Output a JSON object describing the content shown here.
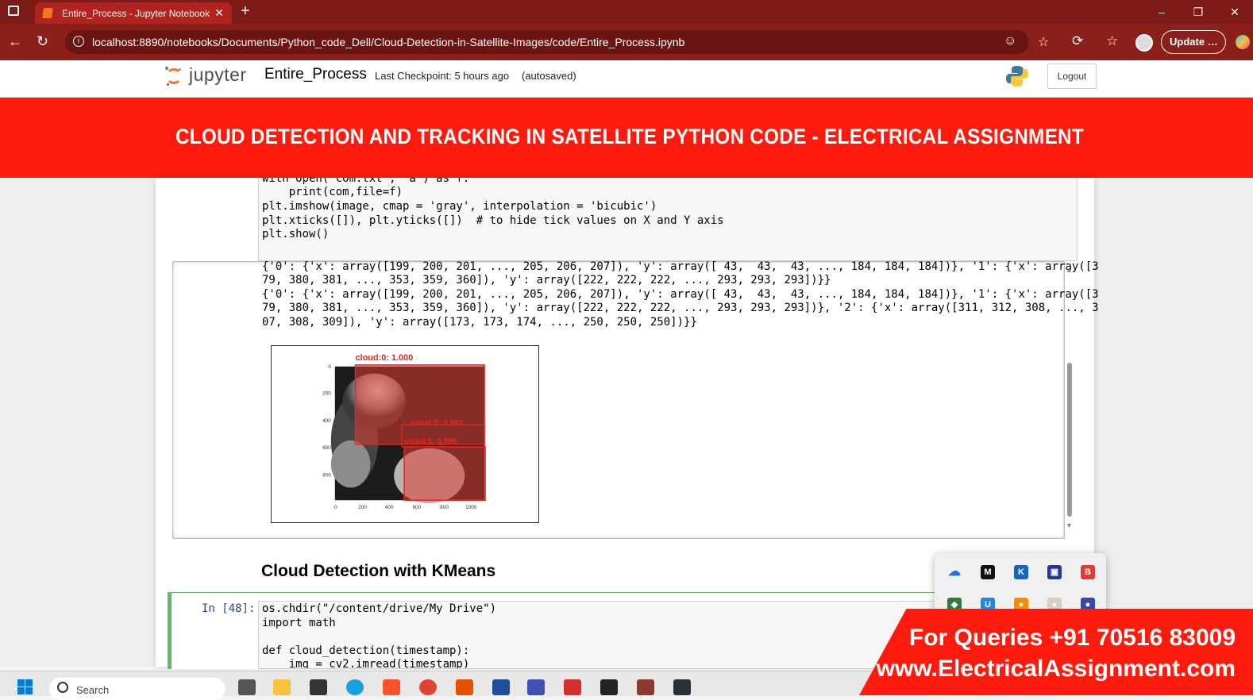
{
  "browser": {
    "tab_title": "Entire_Process - Jupyter Notebook",
    "url": "localhost:8890/notebooks/Documents/Python_code_Dell/Cloud-Detection-in-Satellite-Images/code/Entire_Process.ipynb",
    "update_label": "Update",
    "update_more": "…"
  },
  "jupyter": {
    "logo_text": "jupyter",
    "notebook_name": "Entire_Process",
    "checkpoint": "Last Checkpoint: 5 hours ago",
    "autosave": "(autosaved)",
    "logout_label": "Logout"
  },
  "banner": {
    "title": "CLOUD DETECTION AND TRACKING IN SATELLITE PYTHON CODE - ELECTRICAL ASSIGNMENT"
  },
  "prev_cell": {
    "code_lines": [
      "with open('com.txt', 'a') as f:",
      "    print(com,file=f)",
      "plt.imshow(image, cmap = 'gray', interpolation = 'bicubic')",
      "plt.xticks([]), plt.yticks([])  # to hide tick values on X and Y axis",
      "plt.show()"
    ]
  },
  "output": {
    "lines": [
      "{'0': {'x': array([199, 200, 201, ..., 205, 206, 207]), 'y': array([ 43,  43,  43, ..., 184, 184, 184])}, '1': {'x': array([3",
      "79, 380, 381, ..., 353, 359, 360]), 'y': array([222, 222, 222, ..., 293, 293, 293])}}",
      "{'0': {'x': array([199, 200, 201, ..., 205, 206, 207]), 'y': array([ 43,  43,  43, ..., 184, 184, 184])}, '1': {'x': array([3",
      "79, 380, 381, ..., 353, 359, 360]), 'y': array([222, 222, 222, ..., 293, 293, 293])}, '2': {'x': array([311, 312, 308, ..., 3",
      "07, 308, 309]), 'y': array([173, 173, 174, ..., 250, 250, 250])}}"
    ]
  },
  "figure": {
    "label_top": "cloud:0: 1.000",
    "label_mid": "cloud:2: 0.982",
    "label_low": "cloud:1: 0.996",
    "y_ticks": [
      "0",
      "200",
      "400",
      "600",
      "800"
    ],
    "x_ticks": [
      "0",
      "200",
      "400",
      "600",
      "800",
      "1000"
    ],
    "box_color": "#e8261e"
  },
  "section": {
    "heading": "Cloud Detection with KMeans"
  },
  "cell48": {
    "prompt": "In [48]:",
    "code_lines": [
      "os.chdir(\"/content/drive/My Drive\")",
      "import math",
      "",
      "def cloud_detection(timestamp):",
      "    img = cv2.imread(timestamp)"
    ]
  },
  "contact": {
    "line1": "For Queries +91 70516 83009",
    "line2": "www.ElectricalAssignment.com"
  },
  "taskbar": {
    "search_placeholder": "Search"
  },
  "colors": {
    "browser_frame": "#7c1b17",
    "banner_red": "#ff1a0d",
    "jupyter_orange": "#f37626",
    "run_green": "#66bb6a"
  }
}
